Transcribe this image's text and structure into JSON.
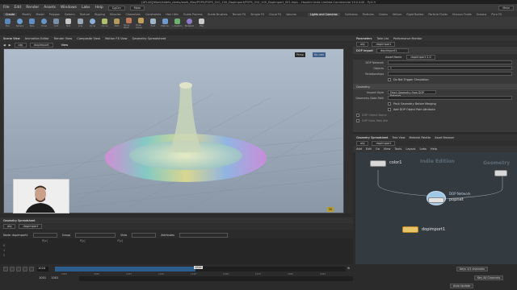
{
  "window": {
    "title": "[ATLAS]/Work/sidefx_demo/work_files/POPS/POPS_010_100_DopImport/POPS_010_100_DopImport_001.hiplc - Houdini Indie Limited-Commercial 19.0.440 - Py3.9"
  },
  "menu": {
    "items": [
      "File",
      "Edit",
      "Render",
      "Assets",
      "Windows",
      "Labs",
      "Help"
    ],
    "desktop": "CgCm",
    "build": "Main",
    "pane_label": "Main"
  },
  "shelf_tabs": [
    "Create",
    "Modify",
    "Model",
    "Polygon",
    "Deform",
    "Texture",
    "Rigging",
    "Muscles",
    "Characters",
    "Constraints",
    "Hair Utils",
    "Guide Process",
    "Guide Brushes",
    "Terrain FX",
    "Simple FX",
    "Cloud FX",
    "Volume"
  ],
  "shelf_tools": [
    "Box",
    "Sphere",
    "Tube",
    "Torus",
    "Grid",
    "Null",
    "Line",
    "Circle",
    "Curve",
    "Path",
    "Spray Paint",
    "Draw Curve",
    "Font",
    "Platonic",
    "L-System",
    "Metaball",
    "File"
  ],
  "shelf_tabs_right": [
    "Lights and Cameras",
    "Collisions",
    "Particles",
    "Grains",
    "Vellum",
    "Rigid Bodies",
    "Particle Fluids",
    "Viscous Fluids",
    "Oceans",
    "Pyro FX",
    "FEM",
    "Wires",
    "Crowds",
    "Drive Simulation"
  ],
  "path_obj": "obj",
  "path_node": "dopimport",
  "viewport": {
    "tabs": [
      "Scene View",
      "Animation Editor",
      "Render View",
      "Composite View",
      "Motion FX View",
      "Geometry Spreadsheet"
    ],
    "tab_active": "View",
    "camera": "Persp",
    "cam_menu": "No cam",
    "frame_badge": "35"
  },
  "spreadsheet": {
    "tab": "Geometry Spreadsheet",
    "node_label": "Node: dopimport1",
    "group_label": "Group",
    "view_label": "View",
    "attributes_label": "Attributes",
    "columns": [
      "P[x]",
      "P[y]",
      "P[z]"
    ],
    "rows": [
      "0",
      "1",
      "2"
    ]
  },
  "timeline": {
    "current_frame": "1024",
    "range_start": "1001",
    "range_start2": "1001",
    "range_end": "1240",
    "range_end2": "1240",
    "marker": "1044",
    "ticks": [
      "1025",
      "1050",
      "1075",
      "1100",
      "1125",
      "1150",
      "1175",
      "1200",
      "1225"
    ]
  },
  "parameters": {
    "tabs": [
      "Parameters",
      "Take List",
      "Performance Monitor"
    ],
    "node_type": "DOP Import",
    "node_name": "dopimport1",
    "subtabs": [
      "Asset Name",
      "dopimport 2.0"
    ],
    "fields": [
      {
        "label": "DOP Network",
        "value": ""
      },
      {
        "label": "Objects",
        "value": "*"
      },
      {
        "label": "Relationships",
        "value": ""
      }
    ],
    "no_trigger": "Do Not Trigger Simulation",
    "section": "Geometry",
    "import_style_label": "Import Style",
    "import_style_value": "Fetch Geometry from DOP Network",
    "geo_path_label": "Geometry Data Path",
    "geo_path_value": "",
    "pack_geo": "Pack Geometry Before Merging",
    "add_attr": "Add DOP Object Path Attribute",
    "dop_object_name": "DOP Object Name",
    "dop_data_path": "DOP Data Path Attr"
  },
  "network": {
    "tabs": [
      "Geometry Spreadsheet",
      "Tree View",
      "Material Palette",
      "Asset Browser"
    ],
    "path_node": "dopimport",
    "menu": [
      "Add",
      "Edit",
      "Go",
      "View",
      "Tools",
      "Layout",
      "Labs",
      "Help"
    ],
    "watermark_left": "Indie Edition",
    "watermark_right": "Geometry",
    "nodes": [
      {
        "name": "color1",
        "type": ""
      },
      {
        "name": "popnet",
        "type": "DOP Network"
      },
      {
        "name": "dopimport1",
        "type": ""
      }
    ],
    "status_left": "Keys 1/1 channels",
    "status_right": "Key All Channels",
    "auto_update": "Auto Update"
  }
}
